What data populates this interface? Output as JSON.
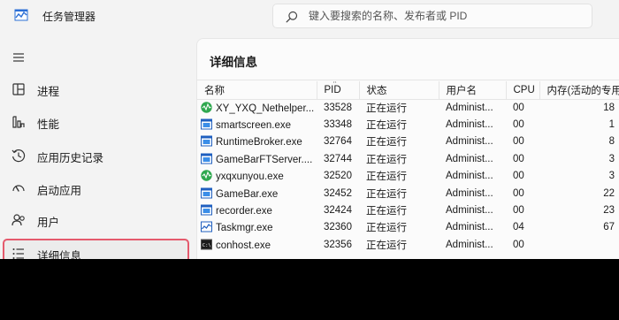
{
  "app": {
    "title": "任务管理器"
  },
  "search": {
    "placeholder": "键入要搜索的名称、发布者或 PID"
  },
  "sidebar": {
    "items": [
      {
        "label": "进程",
        "icon": "processes-icon"
      },
      {
        "label": "性能",
        "icon": "performance-icon"
      },
      {
        "label": "应用历史记录",
        "icon": "history-icon"
      },
      {
        "label": "启动应用",
        "icon": "startup-icon"
      },
      {
        "label": "用户",
        "icon": "users-icon"
      },
      {
        "label": "详细信息",
        "icon": "details-icon",
        "selected": true
      }
    ]
  },
  "main": {
    "title": "详细信息",
    "columns": [
      "名称",
      "PID",
      "状态",
      "用户名",
      "CPU",
      "内存(活动的专用工"
    ],
    "rows": [
      {
        "name": "XY_YXQ_Nethelper...",
        "pid": "33528",
        "status": "正在运行",
        "user": "Administ...",
        "cpu": "00",
        "mem": "18",
        "icon": "green-wave-icon"
      },
      {
        "name": "smartscreen.exe",
        "pid": "33348",
        "status": "正在运行",
        "user": "Administ...",
        "cpu": "00",
        "mem": "1",
        "icon": "app-window-icon"
      },
      {
        "name": "RuntimeBroker.exe",
        "pid": "32764",
        "status": "正在运行",
        "user": "Administ...",
        "cpu": "00",
        "mem": "8",
        "icon": "app-window-icon"
      },
      {
        "name": "GameBarFTServer....",
        "pid": "32744",
        "status": "正在运行",
        "user": "Administ...",
        "cpu": "00",
        "mem": "3",
        "icon": "app-window-icon"
      },
      {
        "name": "yxqxunyou.exe",
        "pid": "32520",
        "status": "正在运行",
        "user": "Administ...",
        "cpu": "00",
        "mem": "3",
        "icon": "green-wave-icon"
      },
      {
        "name": "GameBar.exe",
        "pid": "32452",
        "status": "正在运行",
        "user": "Administ...",
        "cpu": "00",
        "mem": "22",
        "icon": "app-window-icon"
      },
      {
        "name": "recorder.exe",
        "pid": "32424",
        "status": "正在运行",
        "user": "Administ...",
        "cpu": "00",
        "mem": "23",
        "icon": "app-window-icon"
      },
      {
        "name": "Taskmgr.exe",
        "pid": "32360",
        "status": "正在运行",
        "user": "Administ...",
        "cpu": "04",
        "mem": "67",
        "icon": "taskmgr-icon"
      },
      {
        "name": "conhost.exe",
        "pid": "32356",
        "status": "正在运行",
        "user": "Administ...",
        "cpu": "00",
        "mem": "",
        "icon": "console-icon"
      }
    ]
  },
  "colors": {
    "selection_outline": "#e45a6d",
    "accent_green": "#2fa84f",
    "window_bg": "#f3f3f3"
  }
}
